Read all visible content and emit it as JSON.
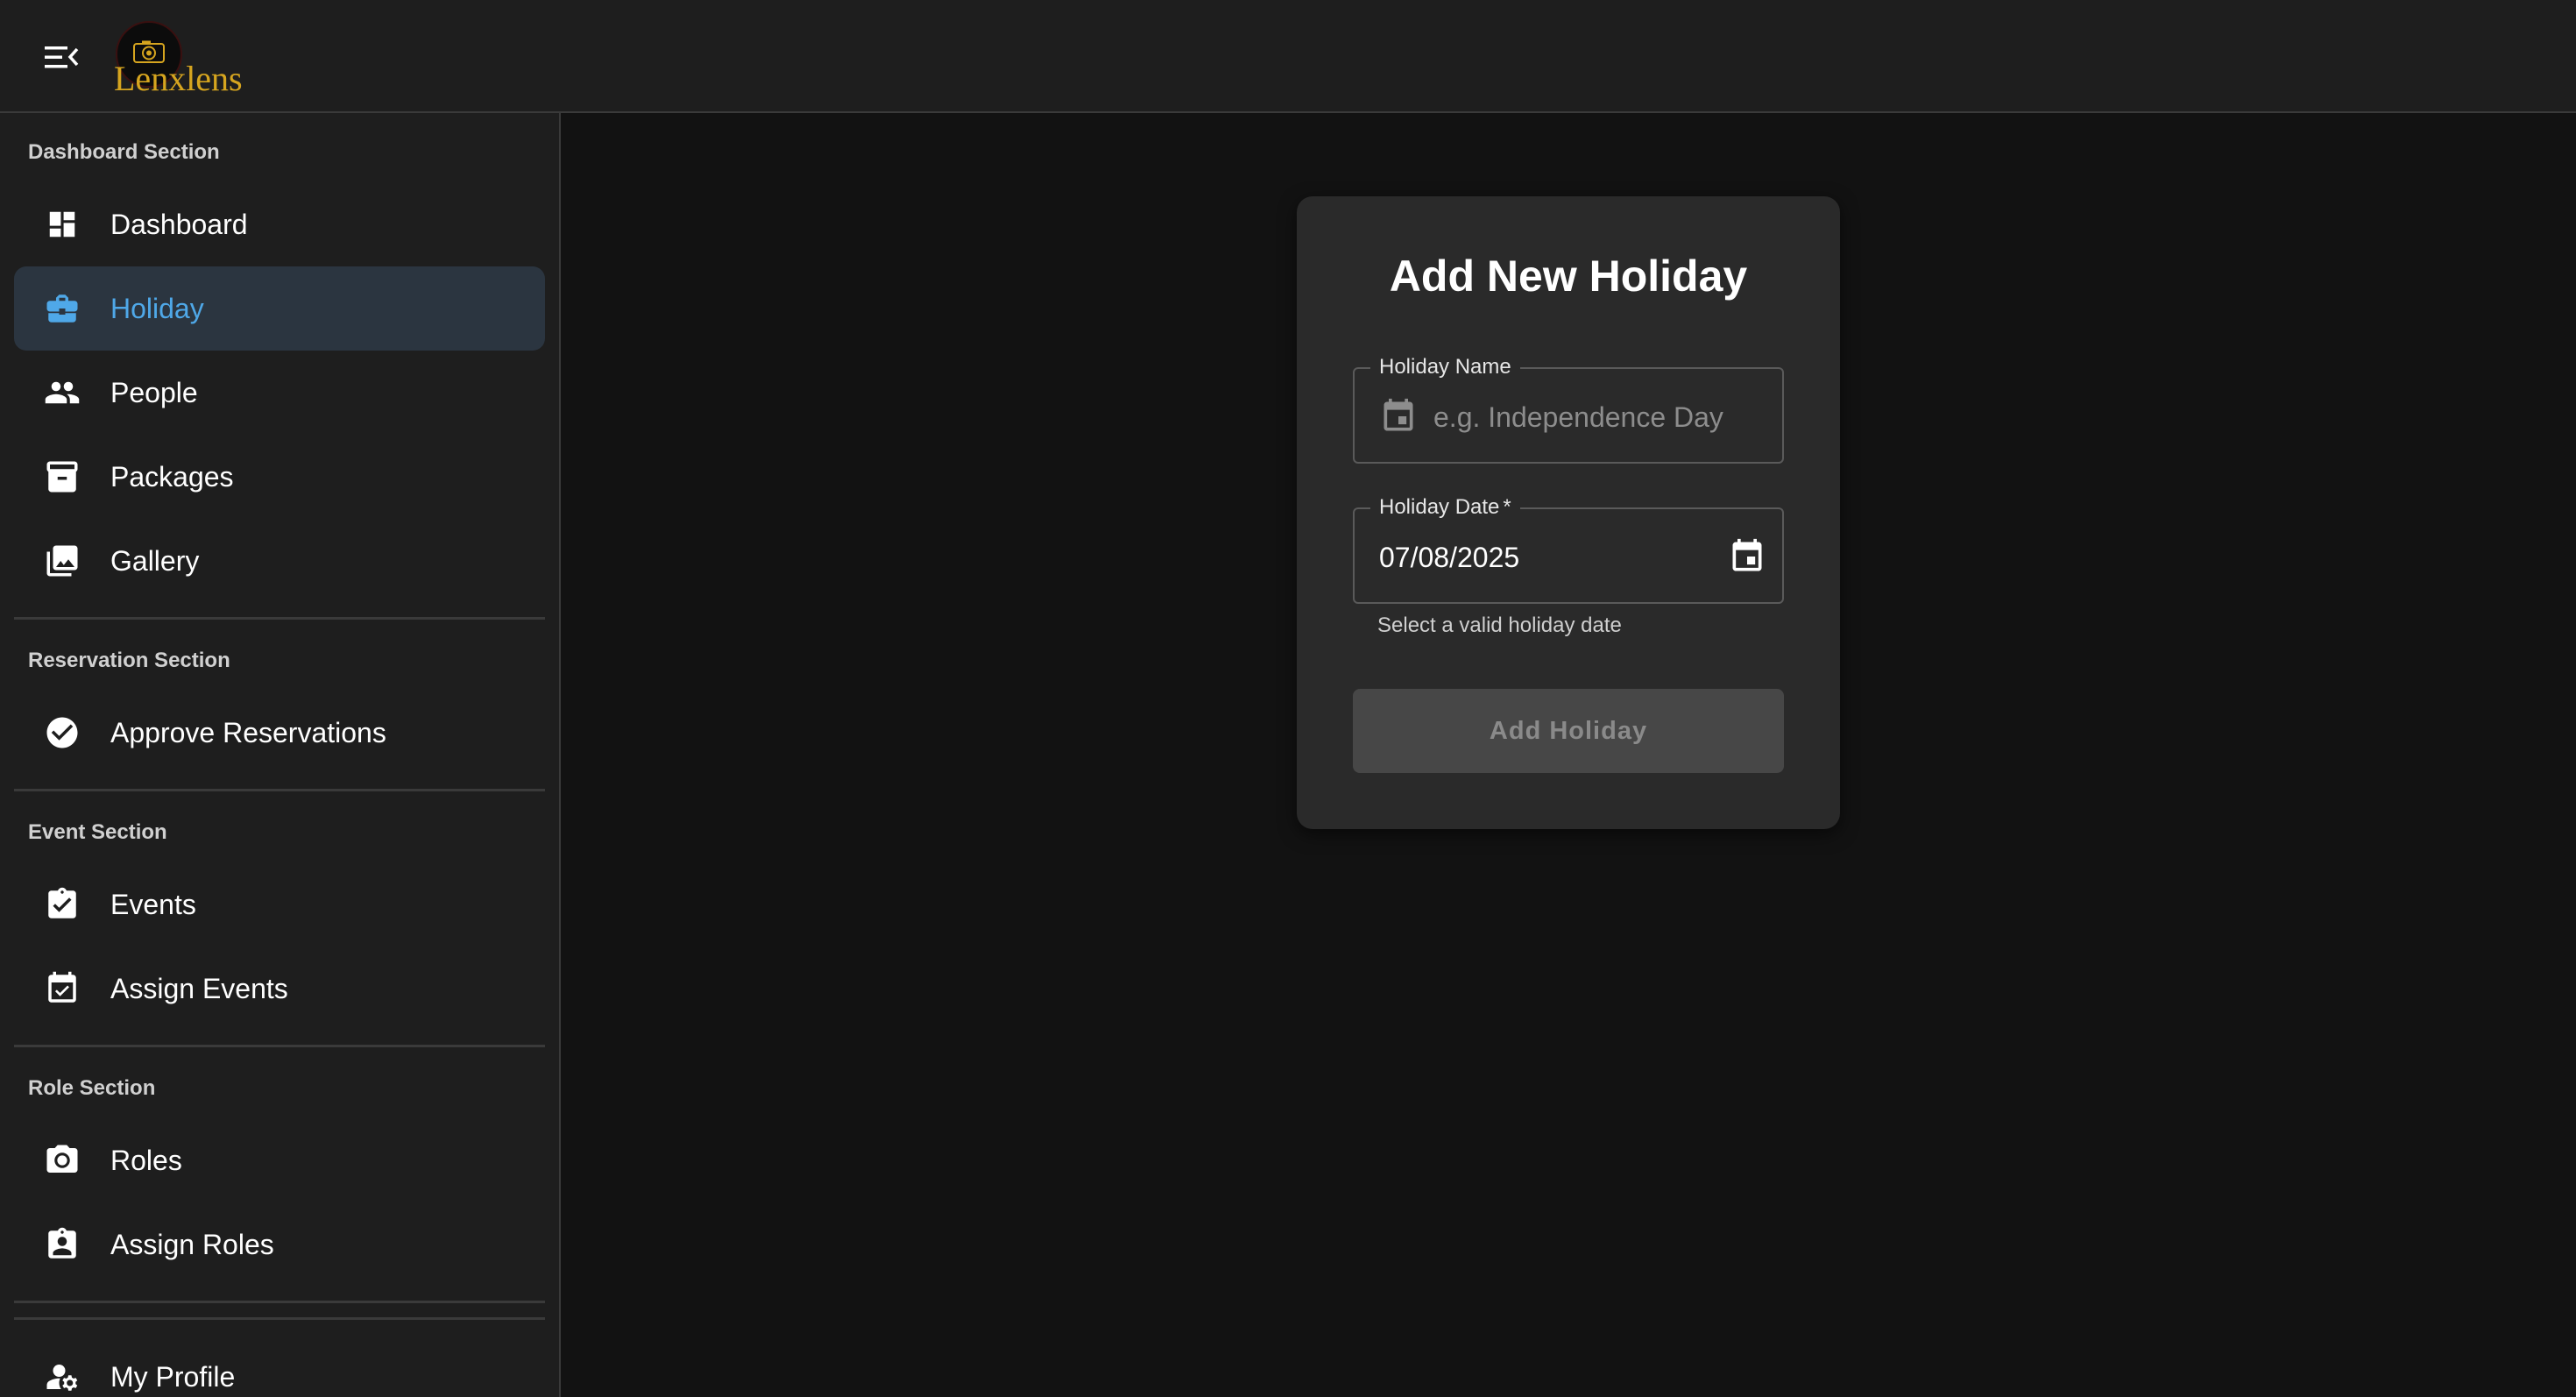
{
  "app": {
    "brand": "Lenxlens",
    "menu_icon": "menu-collapse-icon",
    "brand_color": "#d6a51f",
    "accent_color": "#4fa8e8"
  },
  "sidebar": {
    "sections": [
      {
        "title": "Dashboard Section",
        "items": [
          {
            "label": "Dashboard",
            "icon": "dashboard-icon",
            "active": false
          },
          {
            "label": "Holiday",
            "icon": "briefcase-icon",
            "active": true
          },
          {
            "label": "People",
            "icon": "people-icon",
            "active": false
          },
          {
            "label": "Packages",
            "icon": "archive-icon",
            "active": false
          },
          {
            "label": "Gallery",
            "icon": "photo-library-icon",
            "active": false
          }
        ]
      },
      {
        "title": "Reservation Section",
        "items": [
          {
            "label": "Approve Reservations",
            "icon": "check-circle-icon",
            "active": false
          }
        ]
      },
      {
        "title": "Event Section",
        "items": [
          {
            "label": "Events",
            "icon": "assignment-check-icon",
            "active": false
          },
          {
            "label": "Assign Events",
            "icon": "event-check-icon",
            "active": false
          }
        ]
      },
      {
        "title": "Role Section",
        "items": [
          {
            "label": "Roles",
            "icon": "camera-icon",
            "active": false
          },
          {
            "label": "Assign Roles",
            "icon": "assignment-ind-icon",
            "active": false
          }
        ]
      },
      {
        "title": "",
        "items": [
          {
            "label": "My Profile",
            "icon": "manage-accounts-icon",
            "active": false
          }
        ]
      }
    ]
  },
  "form": {
    "title": "Add New Holiday",
    "name_field": {
      "label": "Holiday Name",
      "placeholder": "e.g. Independence Day",
      "value": "",
      "icon": "calendar-icon"
    },
    "date_field": {
      "label": "Holiday Date",
      "required_mark": "*",
      "value": "07/08/2025",
      "icon": "calendar-icon",
      "helper": "Select a valid holiday date"
    },
    "submit_label": "Add Holiday",
    "submit_disabled": true
  }
}
